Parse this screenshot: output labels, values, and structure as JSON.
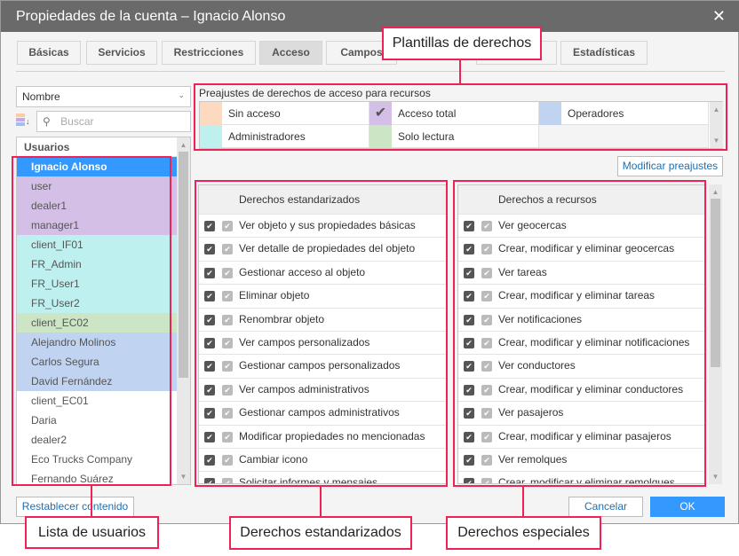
{
  "window": {
    "title": "Propiedades de la cuenta – Ignacio Alonso",
    "close_icon": "close-icon"
  },
  "tabs": [
    {
      "label": "Básicas"
    },
    {
      "label": "Servicios"
    },
    {
      "label": "Restricciones"
    },
    {
      "label": "Acceso",
      "active": true
    },
    {
      "label": "Campos"
    },
    {
      "label": ""
    },
    {
      "label": "Estadísticas"
    }
  ],
  "sort_select": {
    "value": "Nombre"
  },
  "search": {
    "placeholder": "Buscar"
  },
  "users": {
    "header": "Usuarios",
    "items": [
      {
        "name": "Ignacio Alonso",
        "color": "#3399ff",
        "selected": true
      },
      {
        "name": "user",
        "color": "#d4bfe6"
      },
      {
        "name": "dealer1",
        "color": "#d4bfe6"
      },
      {
        "name": "manager1",
        "color": "#d4bfe6"
      },
      {
        "name": "client_IF01",
        "color": "#bff0f0"
      },
      {
        "name": "FR_Admin",
        "color": "#bff0f0"
      },
      {
        "name": "FR_User1",
        "color": "#bff0f0"
      },
      {
        "name": "FR_User2",
        "color": "#bff0f0"
      },
      {
        "name": "client_EC02",
        "color": "#cce5c4"
      },
      {
        "name": "Alejandro Molinos",
        "color": "#c0d4f2"
      },
      {
        "name": "Carlos Segura",
        "color": "#c0d4f2"
      },
      {
        "name": "David Fernández",
        "color": "#c0d4f2"
      },
      {
        "name": "client_EC01",
        "color": "#ffffff"
      },
      {
        "name": "Daria",
        "color": "#ffffff"
      },
      {
        "name": "dealer2",
        "color": "#ffffff"
      },
      {
        "name": "Eco Trucks Company",
        "color": "#ffffff"
      },
      {
        "name": "Fernando Suárez",
        "color": "#ffffff"
      }
    ]
  },
  "presets": {
    "title": "Preajustes de derechos de acceso para recursos",
    "items": [
      {
        "label": "Sin acceso",
        "color": "#fdd9bf"
      },
      {
        "label": "Acceso total",
        "color": "#d4bfe6",
        "checked": true
      },
      {
        "label": "Operadores",
        "color": "#c0d4f2"
      },
      {
        "label": "Administradores",
        "color": "#bff0f0"
      },
      {
        "label": "Solo lectura",
        "color": "#cce5c4"
      }
    ],
    "modify_button": "Modificar preajustes"
  },
  "standard_rights": {
    "header": "Derechos estandarizados",
    "items": [
      "Ver objeto y sus propiedades básicas",
      "Ver detalle de propiedades del objeto",
      "Gestionar acceso al objeto",
      "Eliminar objeto",
      "Renombrar objeto",
      "Ver campos personalizados",
      "Gestionar campos personalizados",
      "Ver campos administrativos",
      "Gestionar campos administrativos",
      "Modificar propiedades no mencionadas",
      "Cambiar icono",
      "Solicitar informes y mensajes"
    ]
  },
  "resource_rights": {
    "header": "Derechos a recursos",
    "items": [
      "Ver geocercas",
      "Crear, modificar y eliminar geocercas",
      "Ver tareas",
      "Crear, modificar y eliminar tareas",
      "Ver notificaciones",
      "Crear, modificar y eliminar notificaciones",
      "Ver conductores",
      "Crear, modificar y eliminar conductores",
      "Ver pasajeros",
      "Crear, modificar y eliminar pasajeros",
      "Ver remolques",
      "Crear, modificar y eliminar remolques"
    ]
  },
  "footer": {
    "reset": "Restablecer contenido",
    "cancel": "Cancelar",
    "ok": "OK"
  },
  "callouts": {
    "templates": "Plantillas de derechos",
    "users": "Lista de usuarios",
    "standard": "Derechos estandarizados",
    "special": "Derechos especiales"
  },
  "colors": {
    "accent": "#3399ff",
    "callout": "#ee2255"
  }
}
